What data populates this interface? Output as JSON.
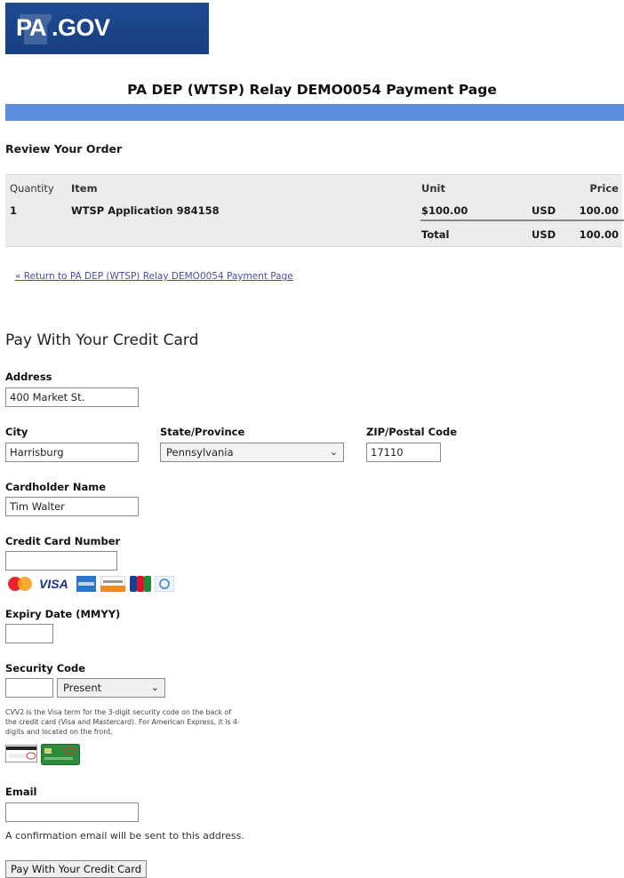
{
  "logo": {
    "text_pa": "PA",
    "text_gov": ".GOV"
  },
  "page": {
    "title": "PA DEP (WTSP) Relay DEMO0054 Payment Page"
  },
  "order": {
    "heading": "Review Your Order",
    "columns": {
      "quantity": "Quantity",
      "item": "Item",
      "unit": "Unit",
      "price": "Price"
    },
    "rows": [
      {
        "quantity": "1",
        "item": "WTSP Application 984158",
        "unit": "$100.00",
        "currency": "USD",
        "price": "100.00"
      }
    ],
    "total": {
      "label": "Total",
      "currency": "USD",
      "amount": "100.00"
    }
  },
  "return_link": "« Return to PA DEP (WTSP) Relay DEMO0054 Payment Page",
  "form": {
    "heading": "Pay With Your Credit Card",
    "address": {
      "label": "Address",
      "value": "400 Market St."
    },
    "city": {
      "label": "City",
      "value": "Harrisburg"
    },
    "state": {
      "label": "State/Province",
      "value": "Pennsylvania"
    },
    "zip": {
      "label": "ZIP/Postal Code",
      "value": "17110"
    },
    "cardholder": {
      "label": "Cardholder Name",
      "value": "Tim Walter"
    },
    "card_number": {
      "label": "Credit Card Number",
      "value": ""
    },
    "card_brands": [
      "mastercard-icon",
      "visa-icon",
      "amex-icon",
      "discover-icon",
      "jcb-icon",
      "diners-icon"
    ],
    "visa_text": "VISA",
    "expiry": {
      "label": "Expiry Date (MMYY)",
      "value": ""
    },
    "security": {
      "label": "Security Code",
      "value": "",
      "presence": "Present"
    },
    "cvv_note": "CVV2 is the Visa term for the 3-digit security code on the back of the credit card (Visa and Mastercard). For American Express, it is 4-digits and located on the front.",
    "email": {
      "label": "Email",
      "value": ""
    },
    "email_note": "A confirmation email will be sent to this address.",
    "submit": "Pay With Your Credit Card"
  },
  "colors": {
    "brand_blue": "#1f4a90",
    "bar_blue": "#5b8fde",
    "link": "#4a4aa8"
  }
}
